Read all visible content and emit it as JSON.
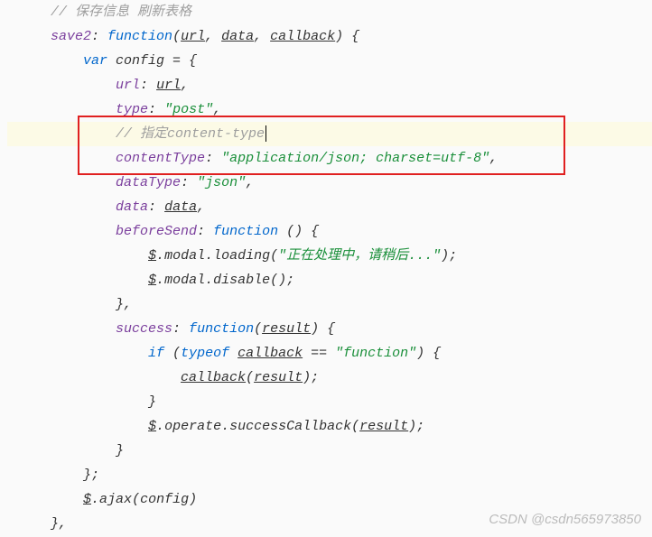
{
  "code": {
    "l1_comment": "// 保存信息 刷新表格",
    "l2_method": "save2",
    "l2_colon": ": ",
    "l2_function": "function",
    "l2_open": "(",
    "l2_p1": "url",
    "l2_c1": ", ",
    "l2_p2": "data",
    "l2_c2": ", ",
    "l2_p3": "callback",
    "l2_close": ") {",
    "l3_var": "var ",
    "l3_config": "config",
    "l3_eq": " = {",
    "l4_key": "url",
    "l4_colon": ": ",
    "l4_val": "url",
    "l4_end": ",",
    "l5_key": "type",
    "l5_colon": ": ",
    "l5_val": "\"post\"",
    "l5_end": ",",
    "l6_comment": "// 指定content-type",
    "l7_key": "contentType",
    "l7_colon": ": ",
    "l7_val": "\"application/json; charset=utf-8\"",
    "l7_end": ",",
    "l8_key": "dataType",
    "l8_colon": ": ",
    "l8_val": "\"json\"",
    "l8_end": ",",
    "l9_key": "data",
    "l9_colon": ": ",
    "l9_val": "data",
    "l9_end": ",",
    "l10_key": "beforeSend",
    "l10_colon": ": ",
    "l10_function": "function",
    "l10_rest": " () {",
    "l11_dollar": "$",
    "l11_dot1": ".",
    "l11_modal": "modal",
    "l11_dot2": ".",
    "l11_loading": "loading",
    "l11_open": "(",
    "l11_str": "\"正在处理中，请稍后...\"",
    "l11_close": ");",
    "l12_dollar": "$",
    "l12_dot1": ".",
    "l12_modal": "modal",
    "l12_dot2": ".",
    "l12_disable": "disable",
    "l12_rest": "();",
    "l13": "},",
    "l14_key": "success",
    "l14_colon": ": ",
    "l14_function": "function",
    "l14_open": "(",
    "l14_p": "result",
    "l14_close": ") {",
    "l15_if": "if ",
    "l15_open": "(",
    "l15_typeof": "typeof ",
    "l15_cb": "callback",
    "l15_eq": " == ",
    "l15_str": "\"function\"",
    "l15_close": ") {",
    "l16_cb": "callback",
    "l16_open": "(",
    "l16_r": "result",
    "l16_close": ");",
    "l17": "}",
    "l18_dollar": "$",
    "l18_dot1": ".",
    "l18_operate": "operate",
    "l18_dot2": ".",
    "l18_scb": "successCallback",
    "l18_open": "(",
    "l18_r": "result",
    "l18_close": ");",
    "l19": "}",
    "l20": "};",
    "l21_dollar": "$",
    "l21_dot": ".",
    "l21_ajax": "ajax",
    "l21_open": "(",
    "l21_cfg": "config",
    "l21_close": ")",
    "l22": "},"
  },
  "watermark": "CSDN @csdn565973850"
}
